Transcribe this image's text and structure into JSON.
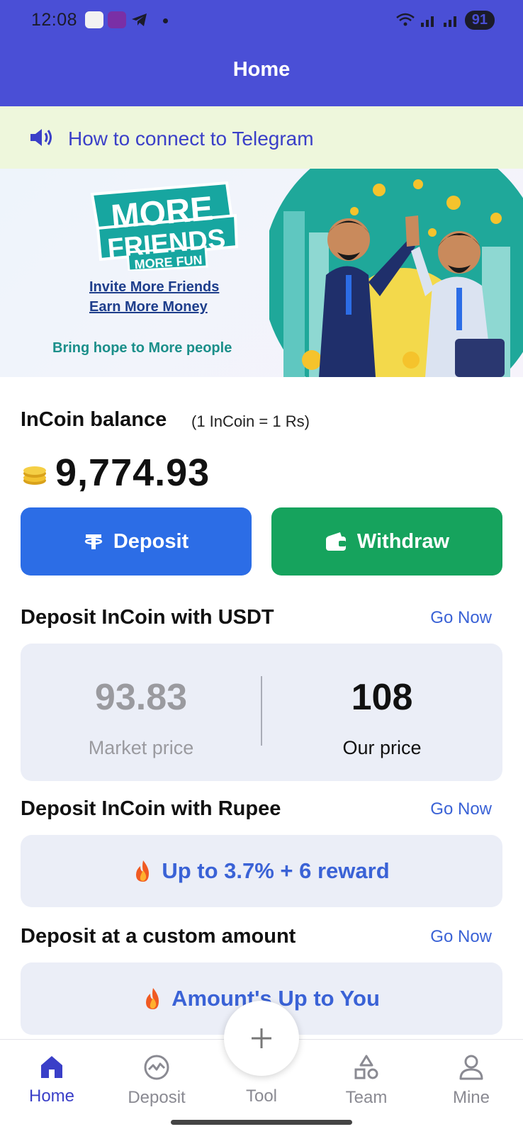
{
  "status_bar": {
    "time": "12:08",
    "battery": "91"
  },
  "header": {
    "title": "Home"
  },
  "notice": {
    "text": "How to connect to Telegram"
  },
  "banner": {
    "logo_line1": "MORE",
    "logo_line2": "FRIENDS",
    "logo_line3": "MORE FUN",
    "line1": "Invite More Friends",
    "line2": "Earn More Money",
    "line3": "Bring hope to More people"
  },
  "balance": {
    "title": "InCoin balance",
    "rate_note": "(1 InCoin = 1 Rs)",
    "value": "9,774.93"
  },
  "actions": {
    "deposit_label": "Deposit",
    "withdraw_label": "Withdraw"
  },
  "usdt_section": {
    "title": "Deposit InCoin with USDT",
    "go_now": "Go Now",
    "market_price_value": "93.83",
    "market_price_label": "Market price",
    "our_price_value": "108",
    "our_price_label": "Our price"
  },
  "rupee_section": {
    "title": "Deposit InCoin with Rupee",
    "go_now": "Go Now",
    "reward_text": "Up to 3.7% + 6 reward"
  },
  "custom_section": {
    "title": "Deposit at a custom amount",
    "go_now": "Go Now",
    "reward_text": "Amount's Up to You"
  },
  "bottom_nav": {
    "items": [
      {
        "label": "Home",
        "icon": "home-icon",
        "active": true
      },
      {
        "label": "Deposit",
        "icon": "deposit-icon",
        "active": false
      },
      {
        "label": "Tool",
        "icon": "plus-icon",
        "active": false
      },
      {
        "label": "Team",
        "icon": "team-icon",
        "active": false
      },
      {
        "label": "Mine",
        "icon": "person-icon",
        "active": false
      }
    ]
  },
  "colors": {
    "header": "#4a4fd6",
    "notice_bg": "#eef7dc",
    "deposit_button": "#2c6de6",
    "withdraw_button": "#16a35d",
    "link": "#3a62d6",
    "card_bg": "#ebeef7"
  }
}
